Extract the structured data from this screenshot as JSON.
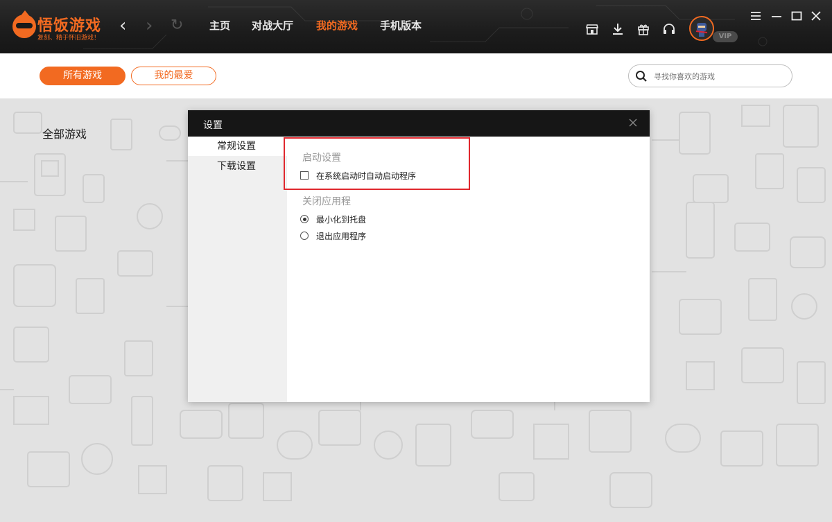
{
  "app": {
    "logo_title": "悟饭游戏",
    "logo_slogan": "复刻、精于怀旧游戏！"
  },
  "nav": {
    "links": [
      {
        "label": "主页",
        "active": false
      },
      {
        "label": "对战大厅",
        "active": false
      },
      {
        "label": "我的游戏",
        "active": true
      },
      {
        "label": "手机版本",
        "active": false
      }
    ]
  },
  "user": {
    "badge": "VIP"
  },
  "filters": {
    "all_games": "所有游戏",
    "favorites": "我的最爱",
    "search_placeholder": "寻找你喜欢的游戏"
  },
  "content": {
    "section_title": "全部游戏"
  },
  "dialog": {
    "title": "设置",
    "side_items": [
      {
        "label": "常规设置",
        "active": true
      },
      {
        "label": "下载设置",
        "active": false
      }
    ],
    "startup": {
      "title": "启动设置",
      "option": {
        "label": "在系统启动时自动启动程序",
        "checked": false
      }
    },
    "close_app": {
      "title": "关闭应用程",
      "options": [
        {
          "label": "最小化到托盘",
          "checked": true
        },
        {
          "label": "退出应用程序",
          "checked": false
        }
      ]
    }
  },
  "colors": {
    "accent": "#f26a21",
    "titlebar": "#1c1c1c",
    "highlight": "#e0282e"
  }
}
